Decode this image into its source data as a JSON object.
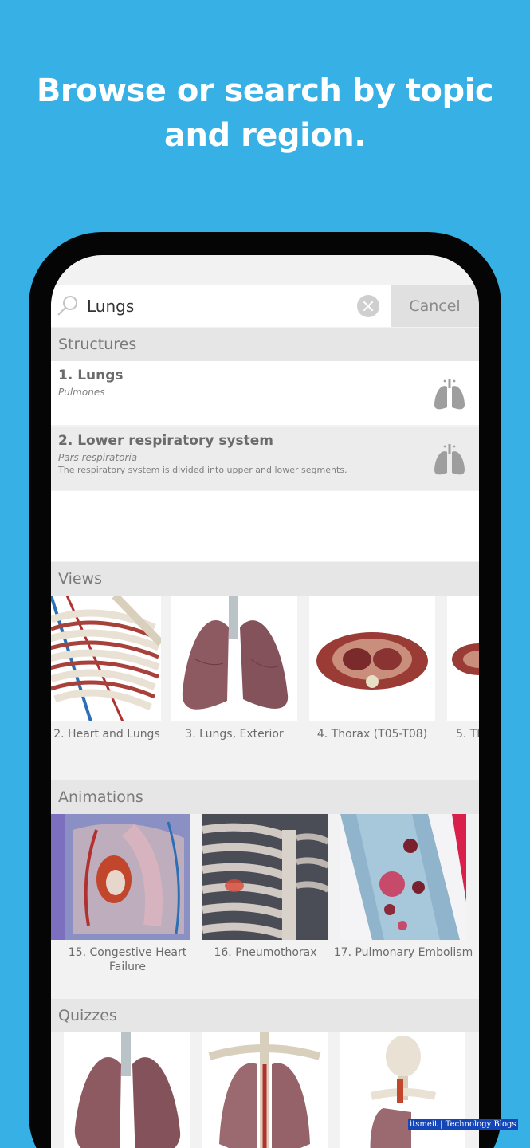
{
  "headline": {
    "line1": "Browse or search by topic",
    "line2": "and region."
  },
  "search": {
    "value": "Lungs",
    "cancel_label": "Cancel"
  },
  "sections": {
    "structures": "Structures",
    "views": "Views",
    "animations": "Animations",
    "quizzes": "Quizzes"
  },
  "structures": [
    {
      "title": "1. Lungs",
      "latin": "Pulmones",
      "description": "",
      "icon": "lungs-icon"
    },
    {
      "title": "2. Lower respiratory system",
      "latin": "Pars respiratoria",
      "description": "The respiratory system is divided into upper and lower segments.",
      "icon": "lungs-icon"
    }
  ],
  "views": [
    {
      "label": "2. Heart and Lungs"
    },
    {
      "label": "3. Lungs, Exterior"
    },
    {
      "label": "4. Thorax (T05-T08)"
    },
    {
      "label": "5. Th"
    }
  ],
  "animations": [
    {
      "label": "15. Congestive Heart Failure"
    },
    {
      "label": "16. Pneumothorax"
    },
    {
      "label": "17. Pulmonary Embolism"
    }
  ],
  "quizzes": [
    {
      "label": ""
    },
    {
      "label": ""
    },
    {
      "label": ""
    }
  ],
  "watermark": "itsmeit | Technology Blogs",
  "colors": {
    "background": "#37b0e5",
    "phone": "#050505",
    "screen": "#f2f2f2",
    "icon_gray": "#9e9e9e"
  }
}
